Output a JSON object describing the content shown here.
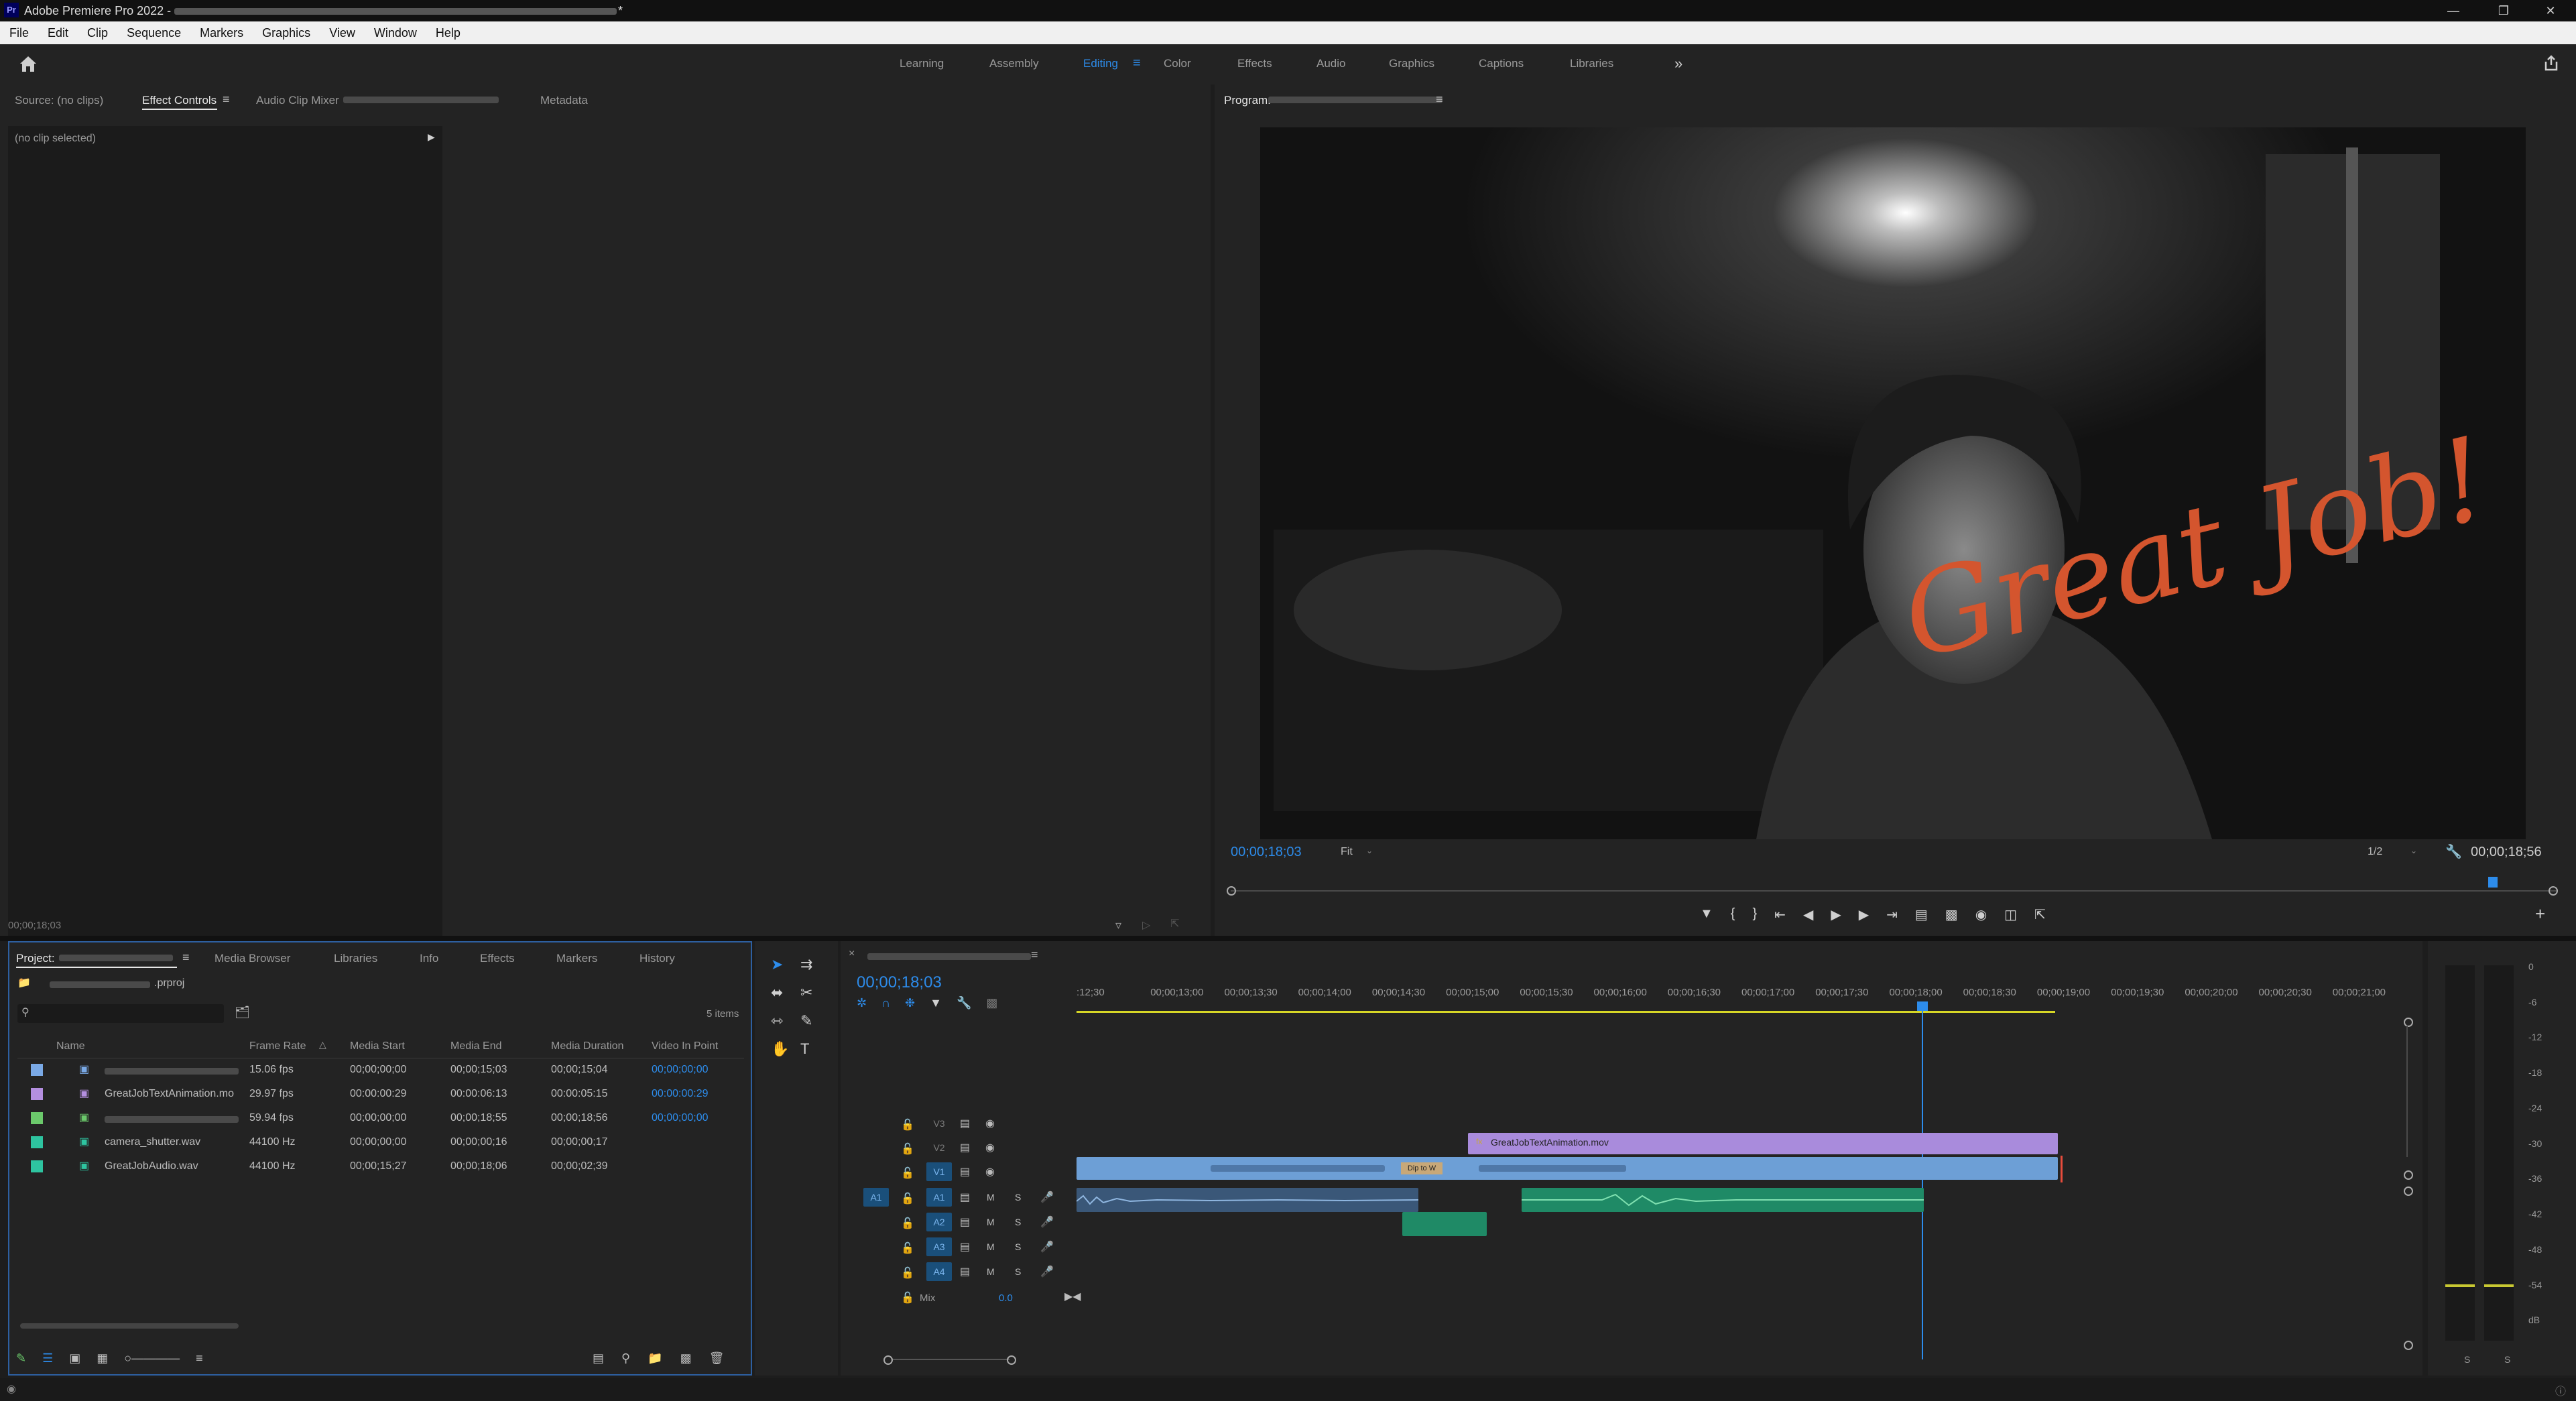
{
  "app": {
    "title": "Adobe Premiere Pro 2022 - ",
    "title_suffix": "*"
  },
  "menu": [
    "File",
    "Edit",
    "Clip",
    "Sequence",
    "Markers",
    "Graphics",
    "View",
    "Window",
    "Help"
  ],
  "workspaces": {
    "tabs": [
      "Learning",
      "Assembly",
      "Editing",
      "Color",
      "Effects",
      "Audio",
      "Graphics",
      "Captions",
      "Libraries"
    ],
    "active": "Editing",
    "more": "»"
  },
  "source_panel": {
    "tabs": [
      "Source: (no clips)",
      "Effect Controls",
      "Audio Clip Mixer",
      "Metadata"
    ],
    "active_tab": "Effect Controls",
    "no_clip_text": "(no clip selected)",
    "timecode": "00;00;18;03"
  },
  "program": {
    "label": "Program:",
    "overlay_text": "Great Job!",
    "current_tc": "00;00;18;03",
    "fit": "Fit",
    "resolution": "1/2",
    "duration_tc": "00;00;18;56"
  },
  "project": {
    "tabs": [
      "Project:",
      "Media Browser",
      "Libraries",
      "Info",
      "Effects",
      "Markers",
      "History"
    ],
    "file_suffix": ".prproj",
    "items_count": "5 items",
    "columns": [
      "Name",
      "Frame Rate",
      "Media Start",
      "Media End",
      "Media Duration",
      "Video In Point"
    ],
    "rows": [
      {
        "color": "#7aa9e6",
        "name": "",
        "fps": "15.06 fps",
        "start": "00;00;00;00",
        "end": "00;00;15;03",
        "dur": "00;00;15;04",
        "in": "00;00;00;00"
      },
      {
        "color": "#b48fe0",
        "name": "GreatJobTextAnimation.mo",
        "fps": "29.97 fps",
        "start": "00:00:00:29",
        "end": "00:00:06:13",
        "dur": "00:00:05:15",
        "in": "00:00:00:29"
      },
      {
        "color": "#6bc96b",
        "name": "",
        "fps": "59.94 fps",
        "start": "00;00;00;00",
        "end": "00;00;18;55",
        "dur": "00;00;18;56",
        "in": "00;00;00;00"
      },
      {
        "color": "#2ec4a0",
        "name": "camera_shutter.wav",
        "fps": "44100 Hz",
        "start": "00;00;00;00",
        "end": "00;00;00;16",
        "dur": "00;00;00;17",
        "in": ""
      },
      {
        "color": "#2ec4a0",
        "name": "GreatJobAudio.wav",
        "fps": "44100 Hz",
        "start": "00;00;15;27",
        "end": "00;00;18;06",
        "dur": "00;00;02;39",
        "in": ""
      }
    ]
  },
  "timeline": {
    "timecode": "00;00;18;03",
    "ruler": [
      ":12;30",
      "00;00;13;00",
      "00;00;13;30",
      "00;00;14;00",
      "00;00;14;30",
      "00;00;15;00",
      "00;00;15;30",
      "00;00;16;00",
      "00;00;16;30",
      "00;00;17;00",
      "00;00;17;30",
      "00;00;18;00",
      "00;00;18;30",
      "00;00;19;00",
      "00;00;19;30",
      "00;00;20;00",
      "00;00;20;30",
      "00;00;21;00"
    ],
    "video_tracks": [
      "V3",
      "V2",
      "V1"
    ],
    "audio_tracks": [
      "A1",
      "A2",
      "A3",
      "A4"
    ],
    "source_patch": "A1",
    "mix_label": "Mix",
    "mix_value": "0.0",
    "clip_text_anim": "GreatJobTextAnimation.mov",
    "clip_transition": "Dip to W",
    "track_m": "M",
    "track_s": "S"
  },
  "meter": {
    "scale": [
      "0",
      "-6",
      "-12",
      "-18",
      "-24",
      "-30",
      "-36",
      "-42",
      "-48",
      "-54",
      "dB"
    ],
    "s_left": "S",
    "s_right": "S"
  },
  "colors": {
    "accent": "#2d8ceb",
    "video_clip": "#6d9fd6",
    "text_clip": "#a98bdc",
    "audio_clip": "#1f8a66"
  }
}
